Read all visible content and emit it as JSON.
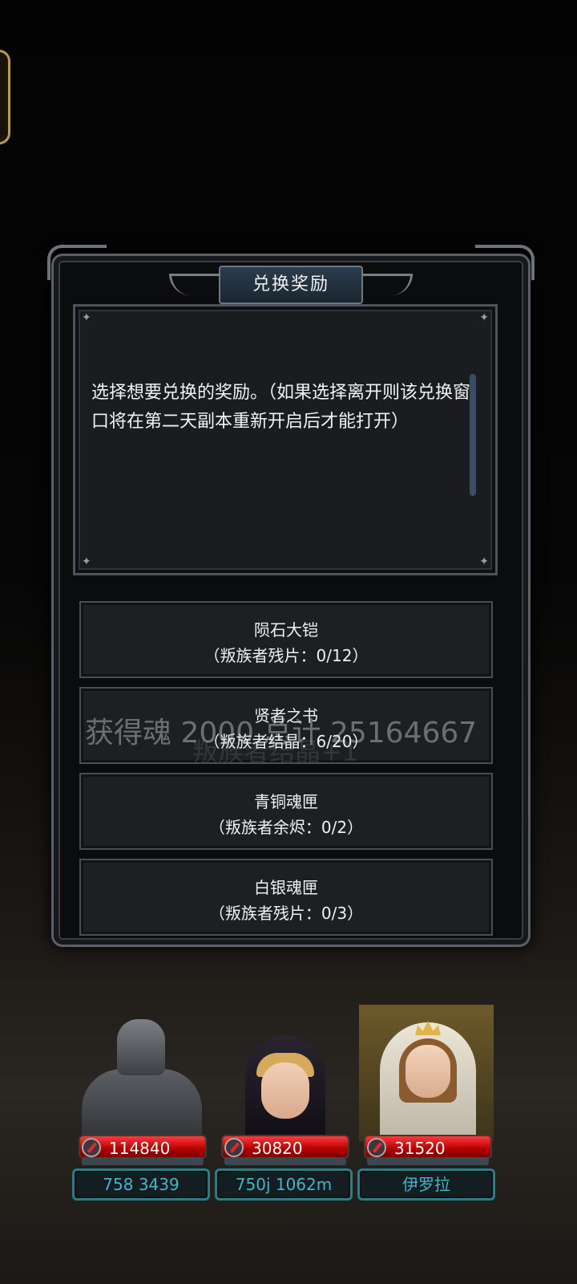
{
  "dialog": {
    "title": "兑换奖励",
    "message": "选择想要兑换的奖励。（如果选择离开则该兑换窗口将在第二天副本重新开启后才能打开）"
  },
  "options": [
    {
      "name": "陨石大铠",
      "requirement": "（叛族者残片：0/12）"
    },
    {
      "name": "贤者之书",
      "requirement": "（叛族者结晶：6/20）"
    },
    {
      "name": "青铜魂匣",
      "requirement": "（叛族者余烬：0/2）"
    },
    {
      "name": "白银魂匣",
      "requirement": "（叛族者残片：0/3）"
    }
  ],
  "floating_text": {
    "line1": "获得魂 2000 总计 25164667",
    "line2": "叛族者结晶+1"
  },
  "party": [
    {
      "hp": "114840",
      "name": "758 3439"
    },
    {
      "hp": "30820",
      "name": "750j 1062m"
    },
    {
      "hp": "31520",
      "name": "伊罗拉"
    }
  ],
  "colors": {
    "hp_bar": "#c40000",
    "name_text": "#3fb7c9",
    "title_plate": "#2c3c4c"
  }
}
